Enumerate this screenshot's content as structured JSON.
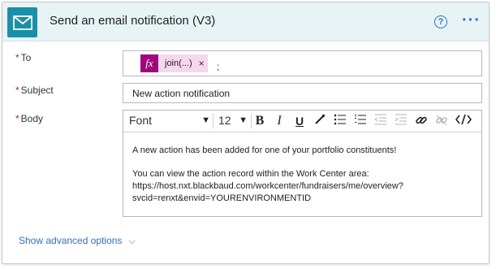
{
  "header": {
    "title": "Send an email notification (V3)",
    "icon": "mail-icon",
    "help_icon": "?",
    "more_icon": "···",
    "accent_color": "#1b8fa8"
  },
  "fields": {
    "to": {
      "label": "To",
      "required_mark": "*",
      "token_icon": "fx",
      "token_text": "join(...)",
      "token_close": "×",
      "separator": ";"
    },
    "subject": {
      "label": "Subject",
      "required_mark": "*",
      "value": "New action notification"
    },
    "body": {
      "label": "Body",
      "required_mark": "*",
      "toolbar": {
        "font": "Font",
        "size": "12",
        "bold": "B",
        "italic": "I",
        "underline": "U"
      },
      "paragraph1": "A new action has been added for one of your portfolio constituents!",
      "paragraph2_line1": "You can view the action record within the Work Center area:",
      "paragraph2_line2": "https://host.nxt.blackbaud.com/workcenter/fundraisers/me/overview?",
      "paragraph2_line3": "svcid=renxt&envid=YOURENVIRONMENTID"
    }
  },
  "footer": {
    "advanced_label": "Show advanced options",
    "chevron": "⌵"
  }
}
